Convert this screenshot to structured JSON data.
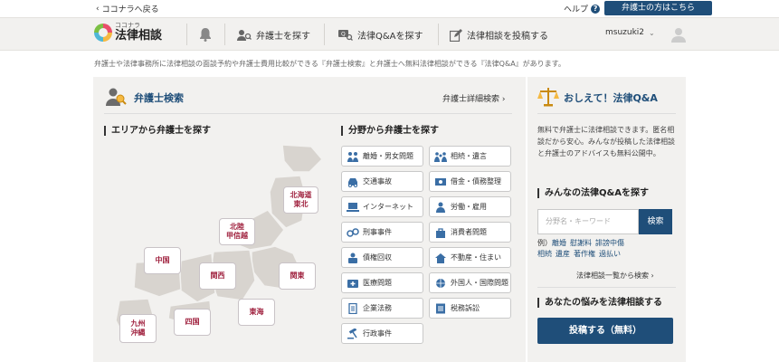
{
  "topbar": {
    "back_label": "ココナラへ戻る",
    "help_label": "ヘルプ",
    "help_icon": "?",
    "lawyer_button": "弁護士の方はこちら"
  },
  "navbar": {
    "logo_small": "ココナラ",
    "logo_big": "法律相談",
    "items": [
      {
        "label": "弁護士を探す",
        "icon": "person-search-icon"
      },
      {
        "label": "法律Q&Aを探す",
        "icon": "qa-search-icon"
      },
      {
        "label": "法律相談を投稿する",
        "icon": "edit-icon"
      }
    ],
    "username": "msuzuki2"
  },
  "description": "弁護士や法律事務所に法律相談の面談予約や弁護士費用比較ができる『弁護士検索』と弁護士へ無料法律相談ができる『法律Q&A』があります。",
  "lawyer_search": {
    "title": "弁護士検索",
    "detail_link": "弁護士詳細検索",
    "area_title": "エリアから弁護士を探す",
    "field_title": "分野から弁護士を探す",
    "regions": [
      {
        "label": "北海道\n東北"
      },
      {
        "label": "北陸\n甲信越"
      },
      {
        "label": "中国"
      },
      {
        "label": "関西"
      },
      {
        "label": "関東"
      },
      {
        "label": "東海"
      },
      {
        "label": "四国"
      },
      {
        "label": "九州\n沖縄"
      }
    ],
    "categories": [
      {
        "label": "離婚・男女問題",
        "icon": "couple-icon"
      },
      {
        "label": "相続・遺言",
        "icon": "family-icon"
      },
      {
        "label": "交通事故",
        "icon": "car-icon"
      },
      {
        "label": "借金・債務整理",
        "icon": "money-icon"
      },
      {
        "label": "インターネット",
        "icon": "computer-icon"
      },
      {
        "label": "労働・雇用",
        "icon": "worker-icon"
      },
      {
        "label": "刑事事件",
        "icon": "handcuffs-icon"
      },
      {
        "label": "消費者問題",
        "icon": "shopping-icon"
      },
      {
        "label": "債権回収",
        "icon": "collection-icon"
      },
      {
        "label": "不動産・住まい",
        "icon": "house-icon"
      },
      {
        "label": "医療問題",
        "icon": "medical-icon"
      },
      {
        "label": "外国人・国際問題",
        "icon": "globe-icon"
      },
      {
        "label": "企業法務",
        "icon": "document-icon"
      },
      {
        "label": "税務訴訟",
        "icon": "tax-icon"
      },
      {
        "label": "行政事件",
        "icon": "gavel-icon"
      }
    ]
  },
  "qa": {
    "title": "おしえて！法律Q&A",
    "intro": "無料で弁護士に法律相談できます。匿名相談だから安心。みんなが投稿した法律相談と弁護士のアドバイスも無料公開中。",
    "search_title": "みんなの法律Q&Aを探す",
    "search_placeholder": "分野名・キーワード",
    "search_button": "検索",
    "example_prefix": "例）",
    "tags": [
      "離婚",
      "慰謝料",
      "誹謗中傷",
      "相続",
      "遺産",
      "著作権",
      "過払い"
    ],
    "list_link": "法律相談一覧から検索",
    "post_title": "あなたの悩みを法律相談する",
    "post_button": "投稿する（無料）"
  },
  "colors": {
    "primary": "#1f4e79",
    "region_text": "#a0223f",
    "panel_bg": "#f2f1ef"
  }
}
